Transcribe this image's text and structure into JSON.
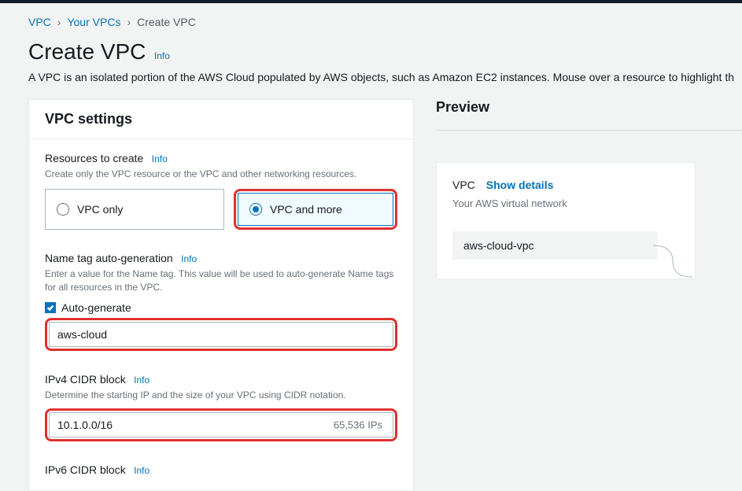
{
  "breadcrumb": {
    "vpc": "VPC",
    "your_vpcs": "Your VPCs",
    "current": "Create VPC"
  },
  "header": {
    "title": "Create VPC",
    "info": "Info",
    "subtitle": "A VPC is an isolated portion of the AWS Cloud populated by AWS objects, such as Amazon EC2 instances. Mouse over a resource to highlight th"
  },
  "settings": {
    "card_title": "VPC settings",
    "resources_to_create": {
      "label": "Resources to create",
      "info": "Info",
      "hint": "Create only the VPC resource or the VPC and other networking resources.",
      "option_vpc_only": "VPC only",
      "option_vpc_and_more": "VPC and more"
    },
    "name_tag": {
      "label": "Name tag auto-generation",
      "info": "Info",
      "hint": "Enter a value for the Name tag. This value will be used to auto-generate Name tags for all resources in the VPC.",
      "checkbox_label": "Auto-generate",
      "value": "aws-cloud"
    },
    "ipv4_cidr": {
      "label": "IPv4 CIDR block",
      "info": "Info",
      "hint": "Determine the starting IP and the size of your VPC using CIDR notation.",
      "value": "10.1.0.0/16",
      "suffix": "65,536 IPs"
    },
    "ipv6_cidr": {
      "label": "IPv6 CIDR block",
      "info": "Info"
    }
  },
  "preview": {
    "title": "Preview",
    "vpc_label": "VPC",
    "show_details": "Show details",
    "sub": "Your AWS virtual network",
    "node_name": "aws-cloud-vpc"
  }
}
